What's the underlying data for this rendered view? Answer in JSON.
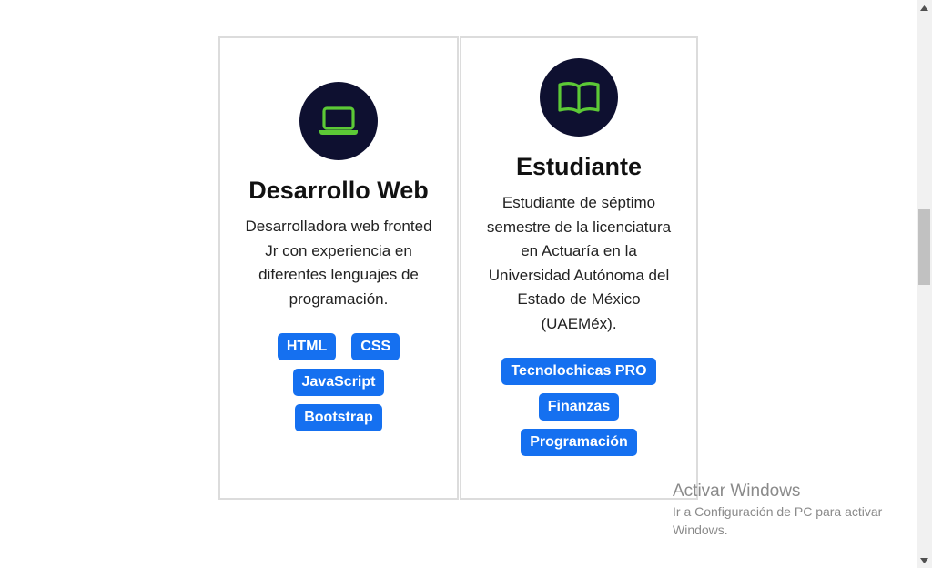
{
  "cards": [
    {
      "icon": "laptop-icon",
      "title": "Desarrollo Web",
      "description": "Desarrolladora web fronted Jr con experiencia en diferentes lenguajes de programación.",
      "tags": [
        "HTML",
        "CSS",
        "JavaScript",
        "Bootstrap"
      ]
    },
    {
      "icon": "book-icon",
      "title": "Estudiante",
      "description": "Estudiante de séptimo semestre de la licenciatura en Actuaría en la Universidad Autónoma del Estado de México (UAEMéx).",
      "tags": [
        "Tecnolochicas PRO",
        "Finanzas",
        "Programación"
      ]
    }
  ],
  "watermark": {
    "title": "Activar Windows",
    "subtitle": "Ir a Configuración de PC para activar Windows."
  },
  "colors": {
    "icon_bg": "#0e1030",
    "icon_fg": "#5cc936",
    "tag_bg": "#1570f0",
    "card_border": "#dcdcdc"
  }
}
